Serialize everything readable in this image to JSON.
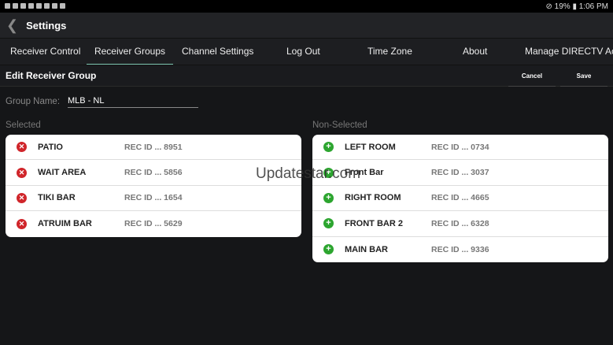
{
  "status_bar": {
    "battery": "19%",
    "time": "1:06 PM"
  },
  "app_bar": {
    "title": "Settings"
  },
  "tabs": [
    {
      "label": "Receiver Control"
    },
    {
      "label": "Receiver Groups",
      "active": true
    },
    {
      "label": "Channel Settings"
    },
    {
      "label": "Log Out"
    },
    {
      "label": "Time Zone"
    },
    {
      "label": "About"
    },
    {
      "label": "Manage DIRECTV Acco"
    }
  ],
  "subheader": {
    "title": "Edit Receiver Group",
    "cancel": "Cancel",
    "save": "Save"
  },
  "group_name": {
    "label": "Group Name:",
    "value": "MLB  - NL"
  },
  "selected": {
    "title": "Selected",
    "items": [
      {
        "name": "PATIO",
        "rec": "REC ID ... 8951"
      },
      {
        "name": "WAIT AREA",
        "rec": "REC ID ... 5856"
      },
      {
        "name": "TIKI BAR",
        "rec": "REC ID ... 1654"
      },
      {
        "name": "ATRUIM BAR",
        "rec": "REC ID ... 5629"
      }
    ]
  },
  "non_selected": {
    "title": "Non-Selected",
    "items": [
      {
        "name": "LEFT ROOM",
        "rec": "REC ID ... 0734"
      },
      {
        "name": "Front Bar",
        "rec": "REC ID ... 3037"
      },
      {
        "name": "RIGHT ROOM",
        "rec": "REC ID ... 4665"
      },
      {
        "name": "FRONT BAR 2",
        "rec": "REC ID ... 6328"
      },
      {
        "name": "MAIN BAR",
        "rec": "REC ID ... 9336"
      }
    ]
  },
  "watermark": "Updatestar.com",
  "colors": {
    "accent": "#7fc8b4",
    "remove": "#d0252a",
    "add": "#2ca52f"
  }
}
